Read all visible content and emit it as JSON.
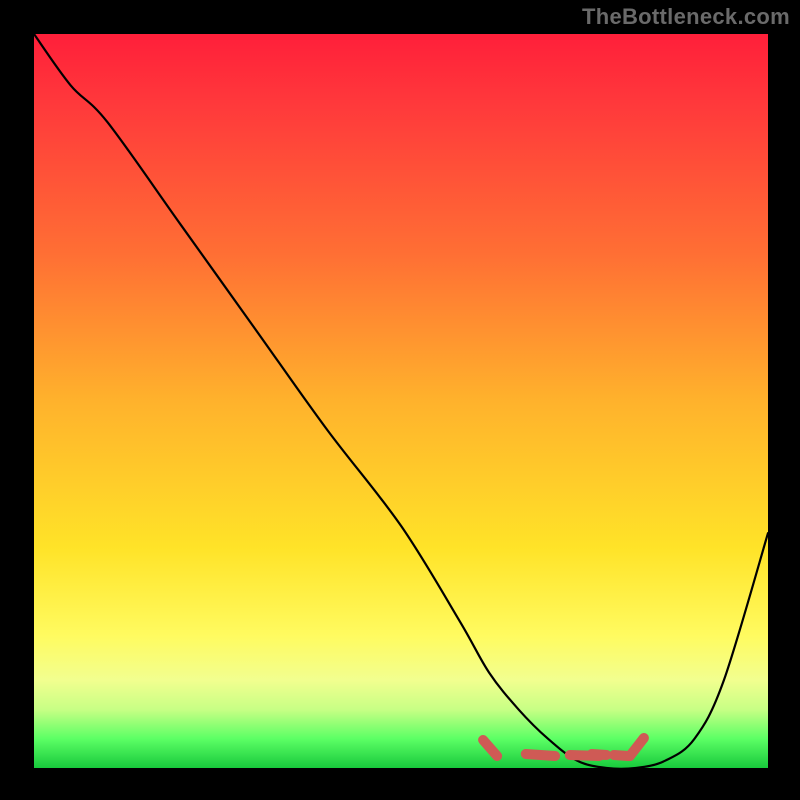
{
  "watermark": "TheBottleneck.com",
  "colors": {
    "background": "#000000",
    "curve": "#000000",
    "marker": "#cf5a55",
    "gradient": [
      "#ff1f3a",
      "#ff3a3b",
      "#ff6f34",
      "#ffb22c",
      "#ffe328",
      "#fffb60",
      "#f2ff8f",
      "#c8ff85",
      "#5cff65",
      "#18c93c"
    ]
  },
  "chart_data": {
    "type": "line",
    "title": "",
    "xlabel": "",
    "ylabel": "",
    "xlim": [
      0,
      100
    ],
    "ylim": [
      0,
      100
    ],
    "grid": false,
    "legend_position": "none",
    "series": [
      {
        "name": "bottleneck-curve",
        "x": [
          0,
          5,
          10,
          20,
          30,
          40,
          50,
          58,
          62,
          66,
          70,
          74,
          78,
          82,
          86,
          90,
          94,
          100
        ],
        "y": [
          100,
          93,
          88,
          74,
          60,
          46,
          33,
          20,
          13,
          8,
          4,
          1,
          0,
          0,
          1,
          4,
          12,
          32
        ]
      }
    ],
    "annotations": [
      {
        "name": "optimal-range-marker",
        "x_start": 62,
        "x_end": 82,
        "y": 0
      }
    ]
  }
}
